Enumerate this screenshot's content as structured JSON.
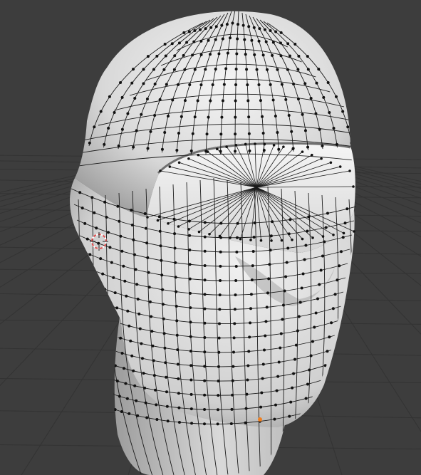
{
  "viewport": {
    "view": "perspective",
    "mode": "edit-mode",
    "shading": "solid",
    "show_grid_floor": true,
    "show_wireframe": true,
    "show_vertices": true
  },
  "colors": {
    "background": "#3d3d3d",
    "grid_line": "#333333",
    "mesh_surface": "#e6e6e6",
    "mesh_shadow": "#9a9a9a",
    "wire": "#1a1a1a",
    "vertex": "#111111",
    "cursor_red": "#e05050",
    "cursor_white": "#ffffff",
    "selected_vertex": "#f08020"
  },
  "objects": [
    {
      "name": "head-mesh",
      "kind": "mesh",
      "selected_vertices": 1
    }
  ],
  "icons": {
    "cursor": "3d-cursor-icon",
    "selected_vertex": "selected-vertex-icon"
  }
}
